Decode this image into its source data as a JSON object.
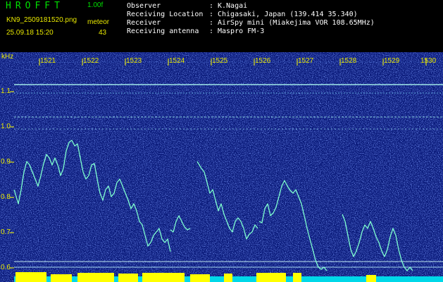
{
  "header": {
    "app_title": "HROFFT",
    "version": "1.00f",
    "filename": "KN9_2509181520.png",
    "datetime": "25.09.18 15:20",
    "meteor_label": "meteor",
    "meteor_count": "43",
    "observer_label": "Observer",
    "observer_value": "K.Nagai",
    "location_label": "Receiving Location",
    "location_value": "Chigasaki, Japan (139.414 35.340)",
    "receiver_label": "Receiver",
    "receiver_value": "AirSpy mini (Miakejima VOR 108.65MHz)",
    "antenna_label": "Receiving antenna",
    "antenna_value": "Maspro FM-3",
    "separator": ":"
  },
  "axis": {
    "unit_label": "kHz",
    "y_ticks": [
      "1.1",
      "1.0",
      "0.9",
      "0.8",
      "0.7",
      "0.6"
    ],
    "x_ticks": [
      "1521",
      "1522",
      "1523",
      "1524",
      "1525",
      "1526",
      "1527",
      "1528",
      "1529",
      "1530"
    ]
  },
  "colors": {
    "background": "#000000",
    "spectrogram": "#0a1a7a",
    "label_green": "#00e000",
    "label_yellow": "#e8e800",
    "signal": "#7fffd0",
    "meteor_bar": "#ffff00",
    "baseline": "#00d8e8"
  }
}
